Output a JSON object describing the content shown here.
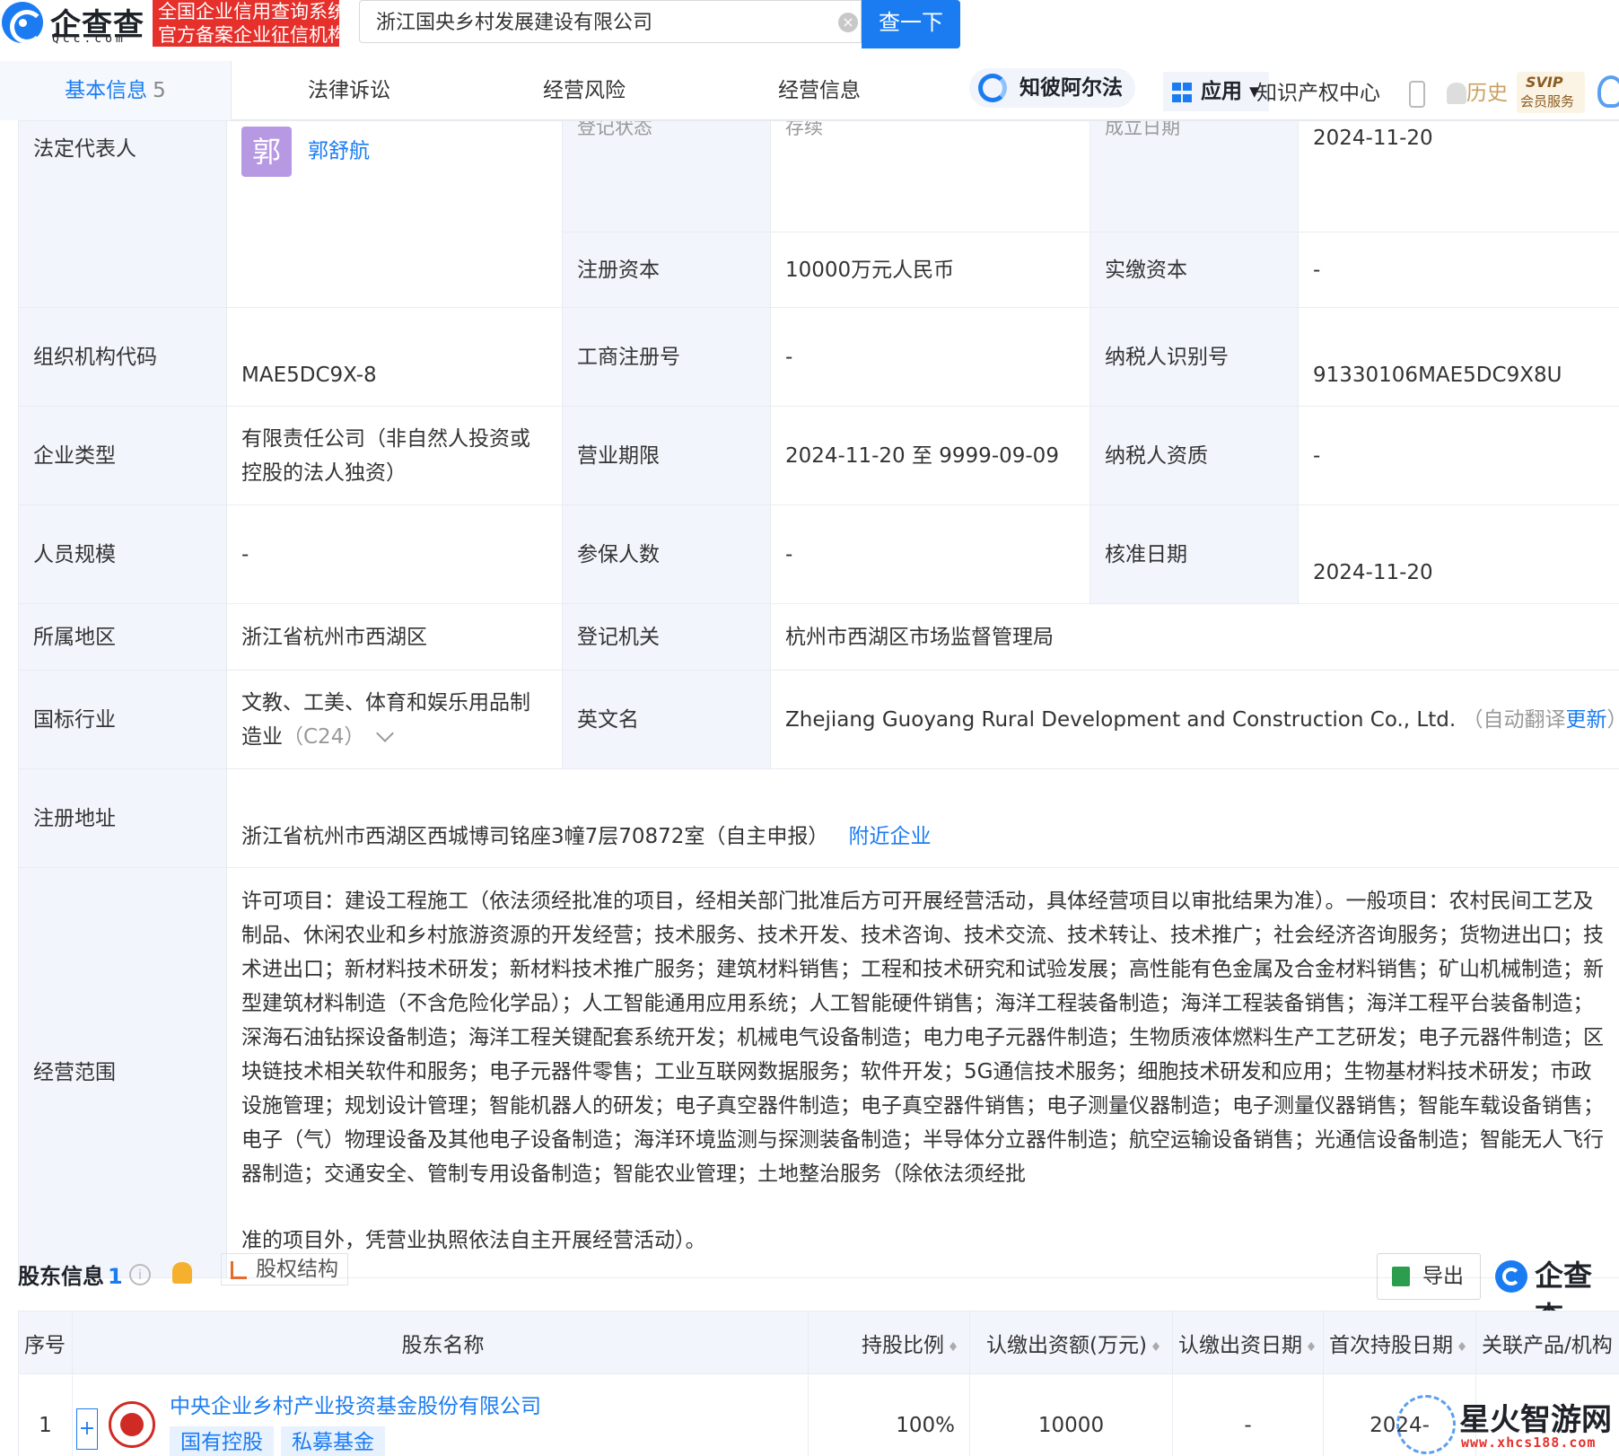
{
  "header": {
    "logo_name": "企查查",
    "logo_domain": "Qcc.com",
    "banner_line1": "全国企业信用查询系统",
    "banner_line2": "官方备案企业征信机构",
    "search_value": "浙江国央乡村发展建设有限公司",
    "search_button": "查一下"
  },
  "tabs": {
    "items": [
      {
        "label": "基本信息",
        "count": "5"
      },
      {
        "label": "法律诉讼"
      },
      {
        "label": "经营风险"
      },
      {
        "label": "经营信息"
      }
    ],
    "zhibi": "知彼阿尔法",
    "app": "应用",
    "ip_center": "知识产权中心",
    "history": "历史",
    "svip_title": "SVIP",
    "svip_sub": "会员服务"
  },
  "info": {
    "legal_rep_label": "法定代表人",
    "legal_rep_avatar": "郭",
    "legal_rep_name": "郭舒航",
    "status_label": "登记状态",
    "status_value": "存续",
    "found_label": "成立日期",
    "found_value": "2024-11-20",
    "reg_capital_label": "注册资本",
    "reg_capital_value": "10000万元人民币",
    "paid_capital_label": "实缴资本",
    "paid_capital_value": "-",
    "org_code_label": "组织机构代码",
    "org_code_value": "MAE5DC9X-8",
    "biz_reg_label": "工商注册号",
    "biz_reg_value": "-",
    "tax_id_label": "纳税人识别号",
    "tax_id_value": "91330106MAE5DC9X8U",
    "type_label": "企业类型",
    "type_value": "有限责任公司（非自然人投资或控股的法人独资）",
    "term_label": "营业期限",
    "term_value": "2024-11-20 至 9999-09-09",
    "taxpayer_label": "纳税人资质",
    "taxpayer_value": "-",
    "staff_label": "人员规模",
    "staff_value": "-",
    "insured_label": "参保人数",
    "insured_value": "-",
    "approve_label": "核准日期",
    "approve_value": "2024-11-20",
    "region_label": "所属地区",
    "region_value": "浙江省杭州市西湖区",
    "authority_label": "登记机关",
    "authority_value": "杭州市西湖区市场监督管理局",
    "industry_label": "国标行业",
    "industry_value": "文教、工美、体育和娱乐用品制造业",
    "industry_code": "（C24）",
    "en_label": "英文名",
    "en_value": "Zhejiang Guoyang Rural Development and Construction Co., Ltd.",
    "en_note_prefix": "（自动翻译",
    "en_note_link": "更新",
    "en_note_suffix": "）",
    "address_label": "注册地址",
    "address_value": "浙江省杭州市西湖区西城博司铭座3幢7层70872室（自主申报）",
    "address_link": "附近企业",
    "scope_label": "经营范围",
    "scope_value": "许可项目：建设工程施工（依法须经批准的项目，经相关部门批准后方可开展经营活动，具体经营项目以审批结果为准）。一般项目：农村民间工艺及制品、休闲农业和乡村旅游资源的开发经营；技术服务、技术开发、技术咨询、技术交流、技术转让、技术推广；社会经济咨询服务；货物进出口；技术进出口；新材料技术研发；新材料技术推广服务；建筑材料销售；工程和技术研究和试验发展；高性能有色金属及合金材料销售；矿山机械制造；新型建筑材料制造（不含危险化学品）；人工智能通用应用系统；人工智能硬件销售；海洋工程装备制造；海洋工程装备销售；海洋工程平台装备制造；深海石油钻探设备制造；海洋工程关键配套系统开发；机械电气设备制造；电力电子元器件制造；生物质液体燃料生产工艺研发；电子元器件制造；区块链技术相关软件和服务；电子元器件零售；工业互联网数据服务；软件开发；5G通信技术服务；细胞技术研发和应用；生物基材料技术研发；市政设施管理；规划设计管理；智能机器人的研发；电子真空器件制造；电子真空器件销售；电子测量仪器制造；电子测量仪器销售；智能车载设备销售；电子（气）物理设备及其他电子设备制造；海洋环境监测与探测装备制造；半导体分立器件制造；航空运输设备销售；光通信设备制造；智能无人飞行器制造；交通安全、管制专用设备制造；智能农业管理；土地整治服务（除依法须经批",
    "scope_last": "准的项目外，凭营业执照依法自主开展经营活动）。"
  },
  "shareholders": {
    "title": "股东信息",
    "count": "1",
    "equity_btn": "股权结构",
    "export_btn": "导出",
    "brand": "企查查",
    "columns": [
      "序号",
      "股东名称",
      "持股比例",
      "认缴出资额(万元)",
      "认缴出资日期",
      "首次持股日期",
      "关联产品/机构"
    ],
    "rows": [
      {
        "index": "1",
        "name": "中央企业乡村产业投资基金股份有限公司",
        "tags": [
          "国有控股",
          "私募基金"
        ],
        "ratio": "100%",
        "amount": "10000",
        "date": "-",
        "first_date": "2024-"
      }
    ]
  },
  "watermark": {
    "title": "星火智游网",
    "site": "www.xhcs188.com"
  },
  "icons": [
    "logo-icon",
    "clear-icon",
    "zhibi-icon",
    "apps-icon",
    "phone-icon",
    "bell-icon",
    "svip-icon",
    "service-icon",
    "info-icon",
    "equity-icon",
    "excel-icon",
    "expand-icon",
    "seal-icon",
    "chevron-down-icon"
  ],
  "colors": {
    "accent": "#1b7cf2",
    "banner": "#e5302b",
    "label_bg": "#f2f6fc",
    "avatar": "#b799e3"
  }
}
